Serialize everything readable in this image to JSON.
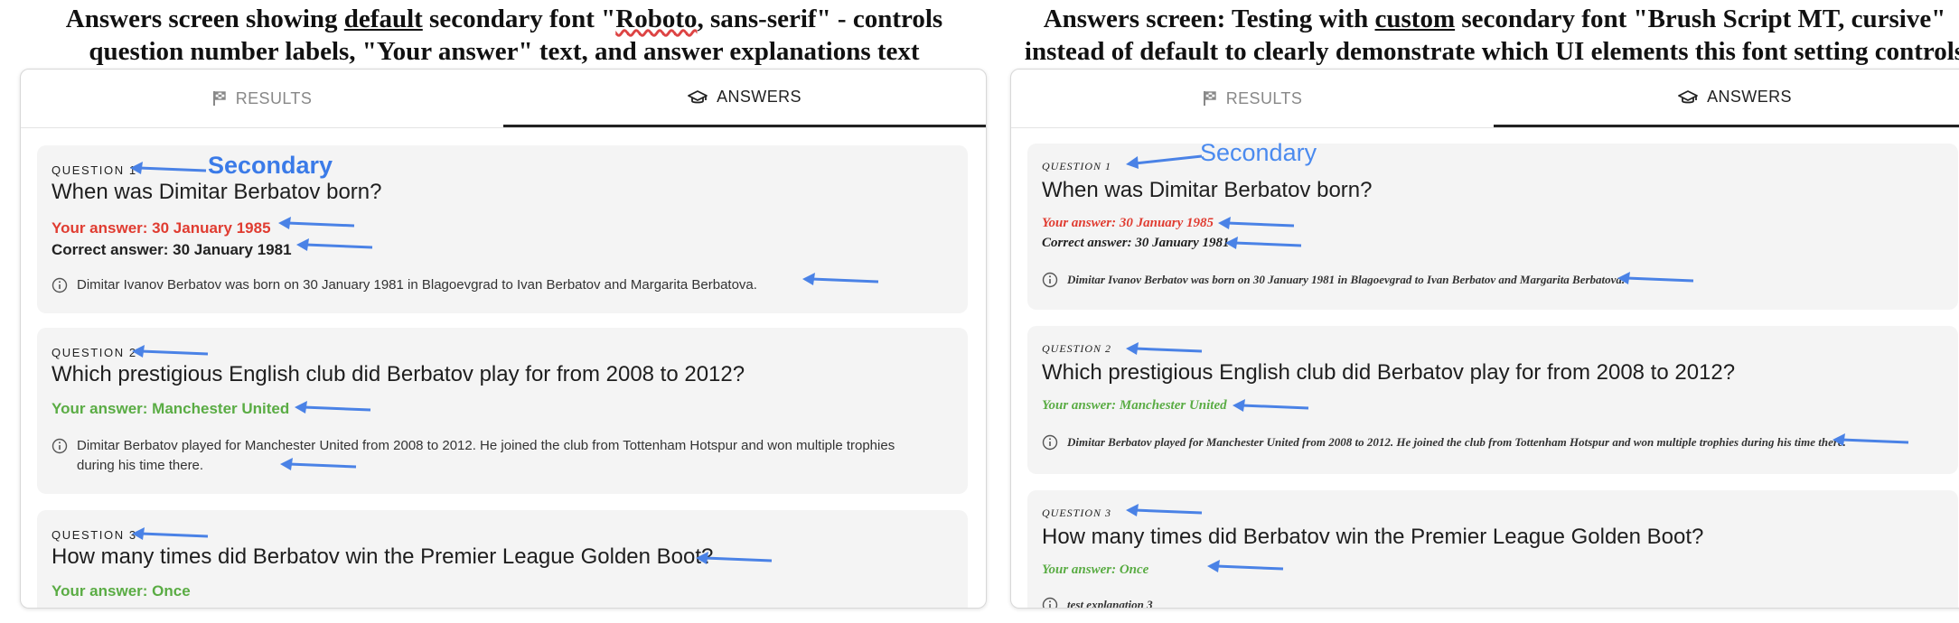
{
  "left": {
    "caption_line1_a": "Answers screen showing ",
    "caption_line1_u": "default",
    "caption_line1_b": " secondary font \"",
    "caption_line1_sq": "Roboto",
    "caption_line1_c": ", sans-serif\" - controls",
    "caption_line2": "question number labels, \"Your answer\" text, and answer explanations text",
    "tabs": {
      "results": "RESULTS",
      "answers": "ANSWERS"
    },
    "annotation": "Secondary",
    "questions": [
      {
        "label": "QUESTION 1",
        "title": "When was Dimitar Berbatov born?",
        "your_answer": "Your answer: 30 January 1985",
        "correct_answer": "Correct answer: 30 January 1981",
        "explanation": "Dimitar Ivanov Berbatov was born on 30 January 1981 in Blagoevgrad to Ivan Berbatov and Margarita Berbatova."
      },
      {
        "label": "QUESTION 2",
        "title": "Which prestigious English club did Berbatov play for from 2008 to 2012?",
        "your_answer": "Your answer: Manchester United",
        "explanation": "Dimitar Berbatov played for Manchester United from 2008 to 2012. He joined the club from Tottenham Hotspur and won multiple trophies during his time there."
      },
      {
        "label": "QUESTION 3",
        "title": "How many times did Berbatov win the Premier League Golden Boot?",
        "your_answer": "Your answer: Once"
      }
    ]
  },
  "right": {
    "caption_line1_a": "Answers screen: Testing with ",
    "caption_line1_u": "custom",
    "caption_line1_b": " secondary font \"Brush Script MT, cursive\"",
    "caption_line2": "instead of default to clearly demonstrate which UI elements this font setting controls",
    "tabs": {
      "results": "RESULTS",
      "answers": "ANSWERS"
    },
    "annotation": "Secondary",
    "questions": [
      {
        "label": "QUESTION 1",
        "title": "When was Dimitar Berbatov born?",
        "your_answer": "Your answer: 30 January 1985",
        "correct_answer": "Correct answer: 30 January 1981",
        "explanation": "Dimitar Ivanov Berbatov was born on 30 January 1981 in Blagoevgrad to Ivan Berbatov and Margarita Berbatova."
      },
      {
        "label": "QUESTION 2",
        "title": "Which prestigious English club did Berbatov play for from 2008 to 2012?",
        "your_answer": "Your answer: Manchester United",
        "explanation": "Dimitar Berbatov played for Manchester United from 2008 to 2012. He joined the club from Tottenham Hotspur and won multiple trophies during his time there."
      },
      {
        "label": "QUESTION 3",
        "title": "How many times did Berbatov win the Premier League Golden Boot?",
        "your_answer": "Your answer: Once",
        "explanation": "test explanation 3"
      }
    ]
  },
  "colors": {
    "arrow": "#4a82e6",
    "wrong": "#e03c31",
    "right": "#5aac44"
  }
}
